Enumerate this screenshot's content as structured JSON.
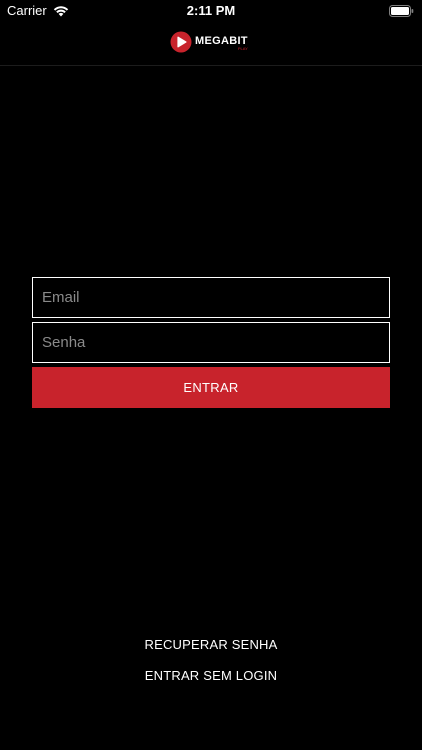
{
  "status_bar": {
    "carrier": "Carrier",
    "time": "2:11 PM",
    "icons": [
      "wifi-icon",
      "battery-icon"
    ]
  },
  "header": {
    "logo_text": "MEGABIT",
    "logo_sub": "PLAY",
    "logo_icon": "play-icon"
  },
  "login": {
    "email_placeholder": "Email",
    "email_value": "",
    "password_placeholder": "Senha",
    "password_value": "",
    "submit_label": "ENTRAR"
  },
  "links": {
    "recover_password": "RECUPERAR SENHA",
    "enter_without_login": "ENTRAR SEM LOGIN"
  },
  "colors": {
    "background": "#000000",
    "accent": "#c8232c",
    "text": "#ffffff",
    "placeholder": "#8a8a8a"
  }
}
